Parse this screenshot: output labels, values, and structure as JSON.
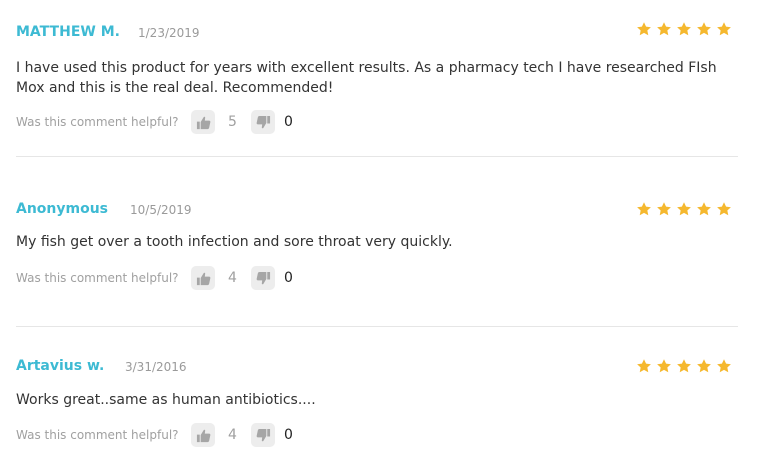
{
  "helpful_prompt": "Was this comment helpful?",
  "star_color": "#f5b82e",
  "author_color": "#3dbad3",
  "reviews": [
    {
      "author": "MATTHEW M.",
      "date": "1/23/2019",
      "rating": 5,
      "text": "I have used this product for years with excellent results. As a pharmacy tech I have researched FIsh Mox and this is the real deal. Recommended!",
      "helpful_up": "5",
      "helpful_down": "0"
    },
    {
      "author": "Anonymous",
      "date": "10/5/2019",
      "rating": 5,
      "text": "My fish get over a tooth infection and sore throat very quickly.",
      "helpful_up": "4",
      "helpful_down": "0"
    },
    {
      "author": "Artavius w.",
      "date": "3/31/2016",
      "rating": 5,
      "text": "Works great..same as human antibiotics....",
      "helpful_up": "4",
      "helpful_down": "0"
    }
  ]
}
